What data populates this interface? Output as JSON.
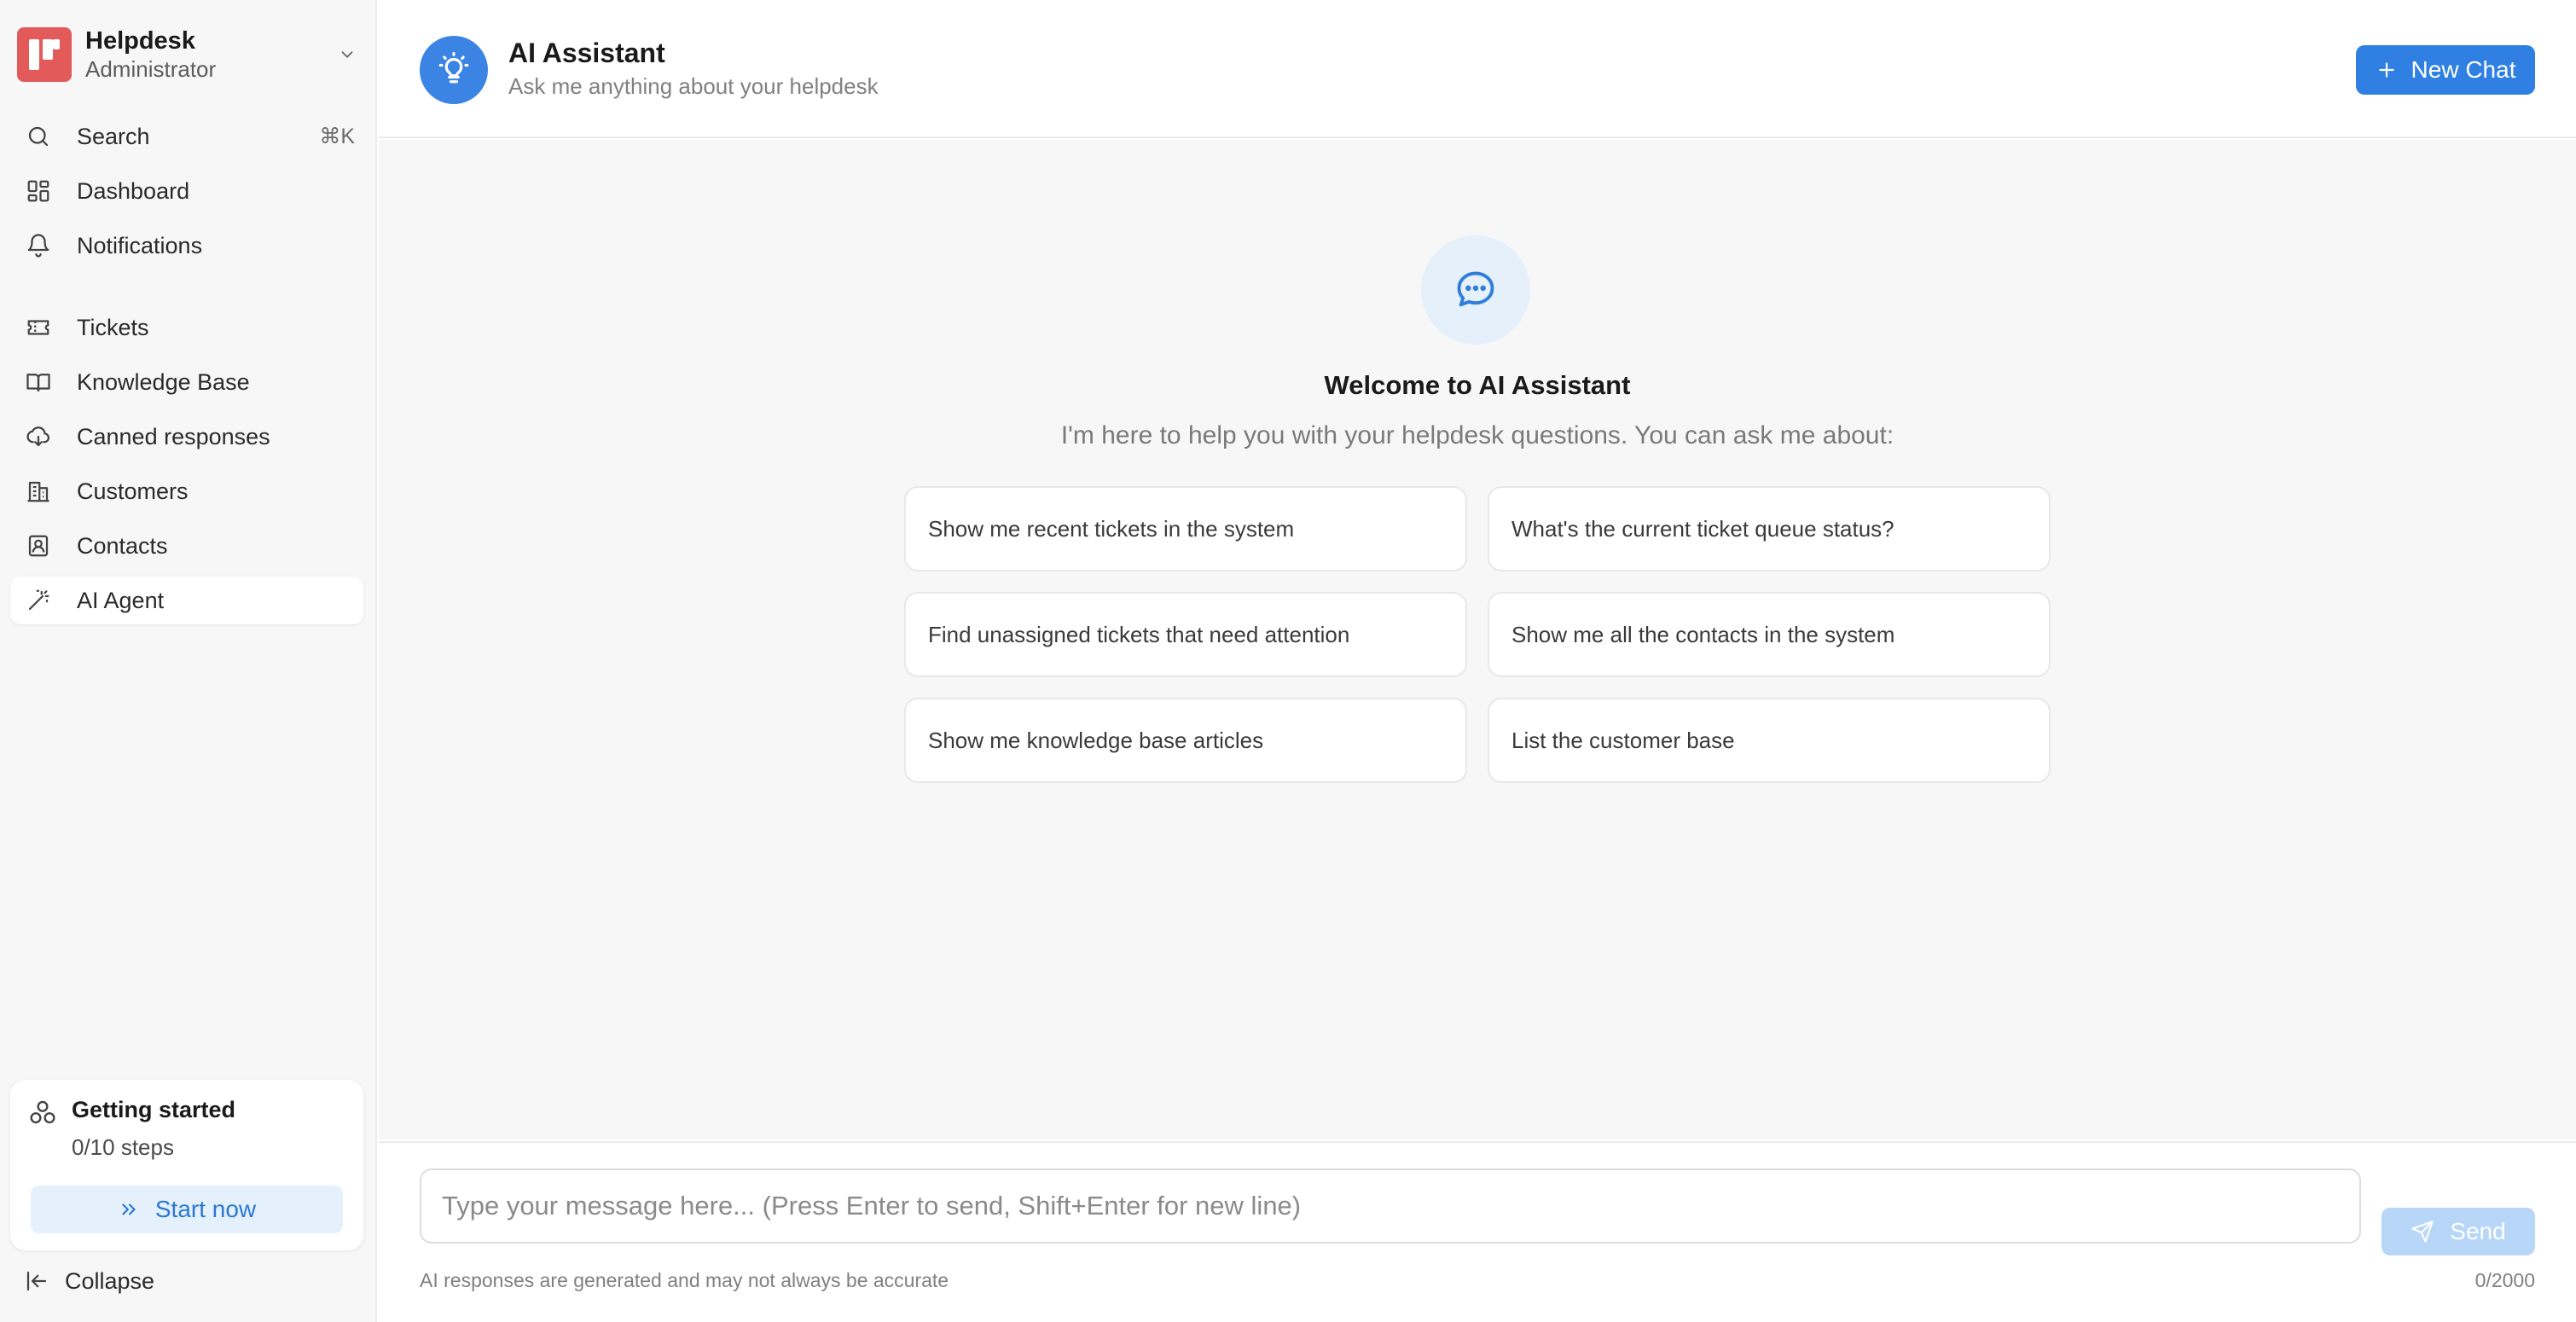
{
  "sidebar": {
    "brand": {
      "name": "Helpdesk",
      "role": "Administrator"
    },
    "search": {
      "label": "Search",
      "shortcut": "⌘K"
    },
    "top_items": [
      {
        "label": "Dashboard",
        "icon": "dashboard-icon"
      },
      {
        "label": "Notifications",
        "icon": "bell-icon"
      }
    ],
    "items": [
      {
        "label": "Tickets",
        "icon": "ticket-icon"
      },
      {
        "label": "Knowledge Base",
        "icon": "book-icon"
      },
      {
        "label": "Canned responses",
        "icon": "cloud-icon"
      },
      {
        "label": "Customers",
        "icon": "building-icon"
      },
      {
        "label": "Contacts",
        "icon": "contact-icon"
      },
      {
        "label": "AI Agent",
        "icon": "magic-wand-icon",
        "active": true
      }
    ],
    "getting_started": {
      "title": "Getting started",
      "steps": "0/10 steps",
      "button": "Start now"
    },
    "collapse": "Collapse"
  },
  "header": {
    "title": "AI Assistant",
    "subtitle": "Ask me anything about your helpdesk",
    "new_chat": "New Chat",
    "accent": "#2f80e2"
  },
  "welcome": {
    "title": "Welcome to AI Assistant",
    "subtitle": "I'm here to help you with your helpdesk questions. You can ask me about:",
    "suggestions": [
      "Show me recent tickets in the system",
      "What's the current ticket queue status?",
      "Find unassigned tickets that need attention",
      "Show me all the contacts in the system",
      "Show me knowledge base articles",
      "List the customer base"
    ]
  },
  "composer": {
    "placeholder": "Type your message here... (Press Enter to send, Shift+Enter for new line)",
    "value": "",
    "send": "Send",
    "disclaimer": "AI responses are generated and may not always be accurate",
    "counter": "0/2000"
  }
}
